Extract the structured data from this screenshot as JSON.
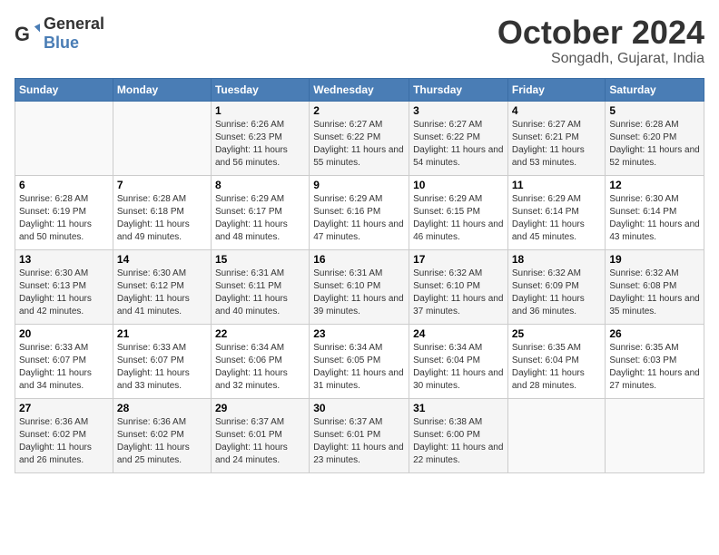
{
  "header": {
    "logo_general": "General",
    "logo_blue": "Blue",
    "month_title": "October 2024",
    "location": "Songadh, Gujarat, India"
  },
  "days_of_week": [
    "Sunday",
    "Monday",
    "Tuesday",
    "Wednesday",
    "Thursday",
    "Friday",
    "Saturday"
  ],
  "weeks": [
    [
      {
        "day": "",
        "sunrise": "",
        "sunset": "",
        "daylight": ""
      },
      {
        "day": "",
        "sunrise": "",
        "sunset": "",
        "daylight": ""
      },
      {
        "day": "1",
        "sunrise": "Sunrise: 6:26 AM",
        "sunset": "Sunset: 6:23 PM",
        "daylight": "Daylight: 11 hours and 56 minutes."
      },
      {
        "day": "2",
        "sunrise": "Sunrise: 6:27 AM",
        "sunset": "Sunset: 6:22 PM",
        "daylight": "Daylight: 11 hours and 55 minutes."
      },
      {
        "day": "3",
        "sunrise": "Sunrise: 6:27 AM",
        "sunset": "Sunset: 6:22 PM",
        "daylight": "Daylight: 11 hours and 54 minutes."
      },
      {
        "day": "4",
        "sunrise": "Sunrise: 6:27 AM",
        "sunset": "Sunset: 6:21 PM",
        "daylight": "Daylight: 11 hours and 53 minutes."
      },
      {
        "day": "5",
        "sunrise": "Sunrise: 6:28 AM",
        "sunset": "Sunset: 6:20 PM",
        "daylight": "Daylight: 11 hours and 52 minutes."
      }
    ],
    [
      {
        "day": "6",
        "sunrise": "Sunrise: 6:28 AM",
        "sunset": "Sunset: 6:19 PM",
        "daylight": "Daylight: 11 hours and 50 minutes."
      },
      {
        "day": "7",
        "sunrise": "Sunrise: 6:28 AM",
        "sunset": "Sunset: 6:18 PM",
        "daylight": "Daylight: 11 hours and 49 minutes."
      },
      {
        "day": "8",
        "sunrise": "Sunrise: 6:29 AM",
        "sunset": "Sunset: 6:17 PM",
        "daylight": "Daylight: 11 hours and 48 minutes."
      },
      {
        "day": "9",
        "sunrise": "Sunrise: 6:29 AM",
        "sunset": "Sunset: 6:16 PM",
        "daylight": "Daylight: 11 hours and 47 minutes."
      },
      {
        "day": "10",
        "sunrise": "Sunrise: 6:29 AM",
        "sunset": "Sunset: 6:15 PM",
        "daylight": "Daylight: 11 hours and 46 minutes."
      },
      {
        "day": "11",
        "sunrise": "Sunrise: 6:29 AM",
        "sunset": "Sunset: 6:14 PM",
        "daylight": "Daylight: 11 hours and 45 minutes."
      },
      {
        "day": "12",
        "sunrise": "Sunrise: 6:30 AM",
        "sunset": "Sunset: 6:14 PM",
        "daylight": "Daylight: 11 hours and 43 minutes."
      }
    ],
    [
      {
        "day": "13",
        "sunrise": "Sunrise: 6:30 AM",
        "sunset": "Sunset: 6:13 PM",
        "daylight": "Daylight: 11 hours and 42 minutes."
      },
      {
        "day": "14",
        "sunrise": "Sunrise: 6:30 AM",
        "sunset": "Sunset: 6:12 PM",
        "daylight": "Daylight: 11 hours and 41 minutes."
      },
      {
        "day": "15",
        "sunrise": "Sunrise: 6:31 AM",
        "sunset": "Sunset: 6:11 PM",
        "daylight": "Daylight: 11 hours and 40 minutes."
      },
      {
        "day": "16",
        "sunrise": "Sunrise: 6:31 AM",
        "sunset": "Sunset: 6:10 PM",
        "daylight": "Daylight: 11 hours and 39 minutes."
      },
      {
        "day": "17",
        "sunrise": "Sunrise: 6:32 AM",
        "sunset": "Sunset: 6:10 PM",
        "daylight": "Daylight: 11 hours and 37 minutes."
      },
      {
        "day": "18",
        "sunrise": "Sunrise: 6:32 AM",
        "sunset": "Sunset: 6:09 PM",
        "daylight": "Daylight: 11 hours and 36 minutes."
      },
      {
        "day": "19",
        "sunrise": "Sunrise: 6:32 AM",
        "sunset": "Sunset: 6:08 PM",
        "daylight": "Daylight: 11 hours and 35 minutes."
      }
    ],
    [
      {
        "day": "20",
        "sunrise": "Sunrise: 6:33 AM",
        "sunset": "Sunset: 6:07 PM",
        "daylight": "Daylight: 11 hours and 34 minutes."
      },
      {
        "day": "21",
        "sunrise": "Sunrise: 6:33 AM",
        "sunset": "Sunset: 6:07 PM",
        "daylight": "Daylight: 11 hours and 33 minutes."
      },
      {
        "day": "22",
        "sunrise": "Sunrise: 6:34 AM",
        "sunset": "Sunset: 6:06 PM",
        "daylight": "Daylight: 11 hours and 32 minutes."
      },
      {
        "day": "23",
        "sunrise": "Sunrise: 6:34 AM",
        "sunset": "Sunset: 6:05 PM",
        "daylight": "Daylight: 11 hours and 31 minutes."
      },
      {
        "day": "24",
        "sunrise": "Sunrise: 6:34 AM",
        "sunset": "Sunset: 6:04 PM",
        "daylight": "Daylight: 11 hours and 30 minutes."
      },
      {
        "day": "25",
        "sunrise": "Sunrise: 6:35 AM",
        "sunset": "Sunset: 6:04 PM",
        "daylight": "Daylight: 11 hours and 28 minutes."
      },
      {
        "day": "26",
        "sunrise": "Sunrise: 6:35 AM",
        "sunset": "Sunset: 6:03 PM",
        "daylight": "Daylight: 11 hours and 27 minutes."
      }
    ],
    [
      {
        "day": "27",
        "sunrise": "Sunrise: 6:36 AM",
        "sunset": "Sunset: 6:02 PM",
        "daylight": "Daylight: 11 hours and 26 minutes."
      },
      {
        "day": "28",
        "sunrise": "Sunrise: 6:36 AM",
        "sunset": "Sunset: 6:02 PM",
        "daylight": "Daylight: 11 hours and 25 minutes."
      },
      {
        "day": "29",
        "sunrise": "Sunrise: 6:37 AM",
        "sunset": "Sunset: 6:01 PM",
        "daylight": "Daylight: 11 hours and 24 minutes."
      },
      {
        "day": "30",
        "sunrise": "Sunrise: 6:37 AM",
        "sunset": "Sunset: 6:01 PM",
        "daylight": "Daylight: 11 hours and 23 minutes."
      },
      {
        "day": "31",
        "sunrise": "Sunrise: 6:38 AM",
        "sunset": "Sunset: 6:00 PM",
        "daylight": "Daylight: 11 hours and 22 minutes."
      },
      {
        "day": "",
        "sunrise": "",
        "sunset": "",
        "daylight": ""
      },
      {
        "day": "",
        "sunrise": "",
        "sunset": "",
        "daylight": ""
      }
    ]
  ]
}
